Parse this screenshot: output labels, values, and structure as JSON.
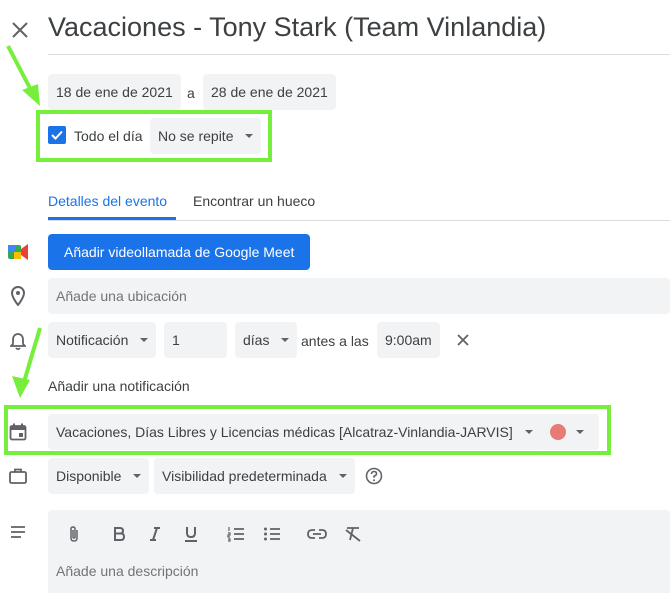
{
  "header": {
    "title": "Vacaciones - Tony Stark (Team Vinlandia)"
  },
  "dates": {
    "start": "18 de ene de 2021",
    "separator": "a",
    "end": "28 de ene de 2021"
  },
  "all_day": {
    "label": "Todo el día",
    "checked": true,
    "repeat": "No se repite"
  },
  "tabs": [
    {
      "label": "Detalles del evento",
      "active": true
    },
    {
      "label": "Encontrar un hueco",
      "active": false
    }
  ],
  "meet": {
    "label": "Añadir videollamada de Google Meet"
  },
  "location": {
    "placeholder": "Añade una ubicación"
  },
  "notification": {
    "type": "Notificación",
    "amount": "1",
    "unit": "días",
    "before_label": "antes a las",
    "time": "9:00am",
    "add_label": "Añadir una notificación"
  },
  "calendar": {
    "name": "Vacaciones, Días Libres y Licencias médicas [Alcatraz-Vinlandia-JARVIS]",
    "color": "#e67c73"
  },
  "availability": {
    "status": "Disponible",
    "visibility": "Visibilidad predeterminada"
  },
  "description": {
    "placeholder": "Añade una descripción"
  },
  "colors": {
    "accent": "#1a73e8",
    "highlight": "#76ee3c"
  },
  "icons": [
    "close-icon",
    "google-meet-icon",
    "location-pin-icon",
    "bell-icon",
    "calendar-icon",
    "briefcase-icon",
    "notes-icon",
    "help-icon",
    "attach-icon",
    "bold-icon",
    "italic-icon",
    "underline-icon",
    "numbered-list-icon",
    "bulleted-list-icon",
    "link-icon",
    "clear-format-icon"
  ]
}
